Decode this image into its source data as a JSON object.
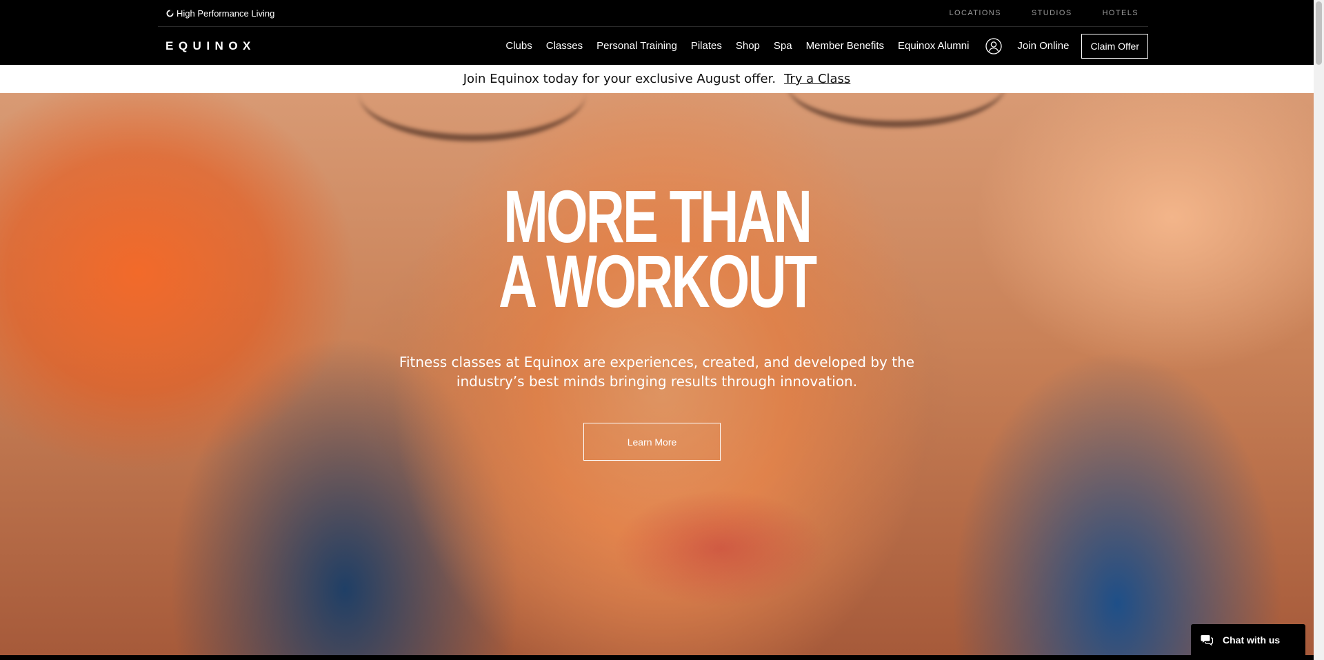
{
  "utility_bar": {
    "tagline": "High Performance Living",
    "links": [
      "LOCATIONS",
      "STUDIOS",
      "HOTELS"
    ]
  },
  "nav": {
    "logo": "EQUINOX",
    "items": [
      "Clubs",
      "Classes",
      "Personal Training",
      "Pilates",
      "Shop",
      "Spa",
      "Member Benefits",
      "Equinox Alumni"
    ],
    "account_icon": "account-icon",
    "join_online": "Join Online",
    "claim_offer": "Claim Offer"
  },
  "promo": {
    "text": "Join Equinox today for your exclusive August offer.",
    "link": "Try a Class"
  },
  "hero": {
    "title_line1": "MORE THAN",
    "title_line2": "A WORKOUT",
    "subtitle_line1": "Fitness classes at Equinox are experiences, created, and developed by the",
    "subtitle_line2": "industry’s best minds bringing results through innovation.",
    "cta": "Learn More"
  },
  "chat": {
    "label": "Chat with us",
    "icon": "chat-bubble-icon"
  },
  "colors": {
    "nav_background": "#000000",
    "promo_background": "#ffffff",
    "utility_link": "#9a9a9a"
  }
}
